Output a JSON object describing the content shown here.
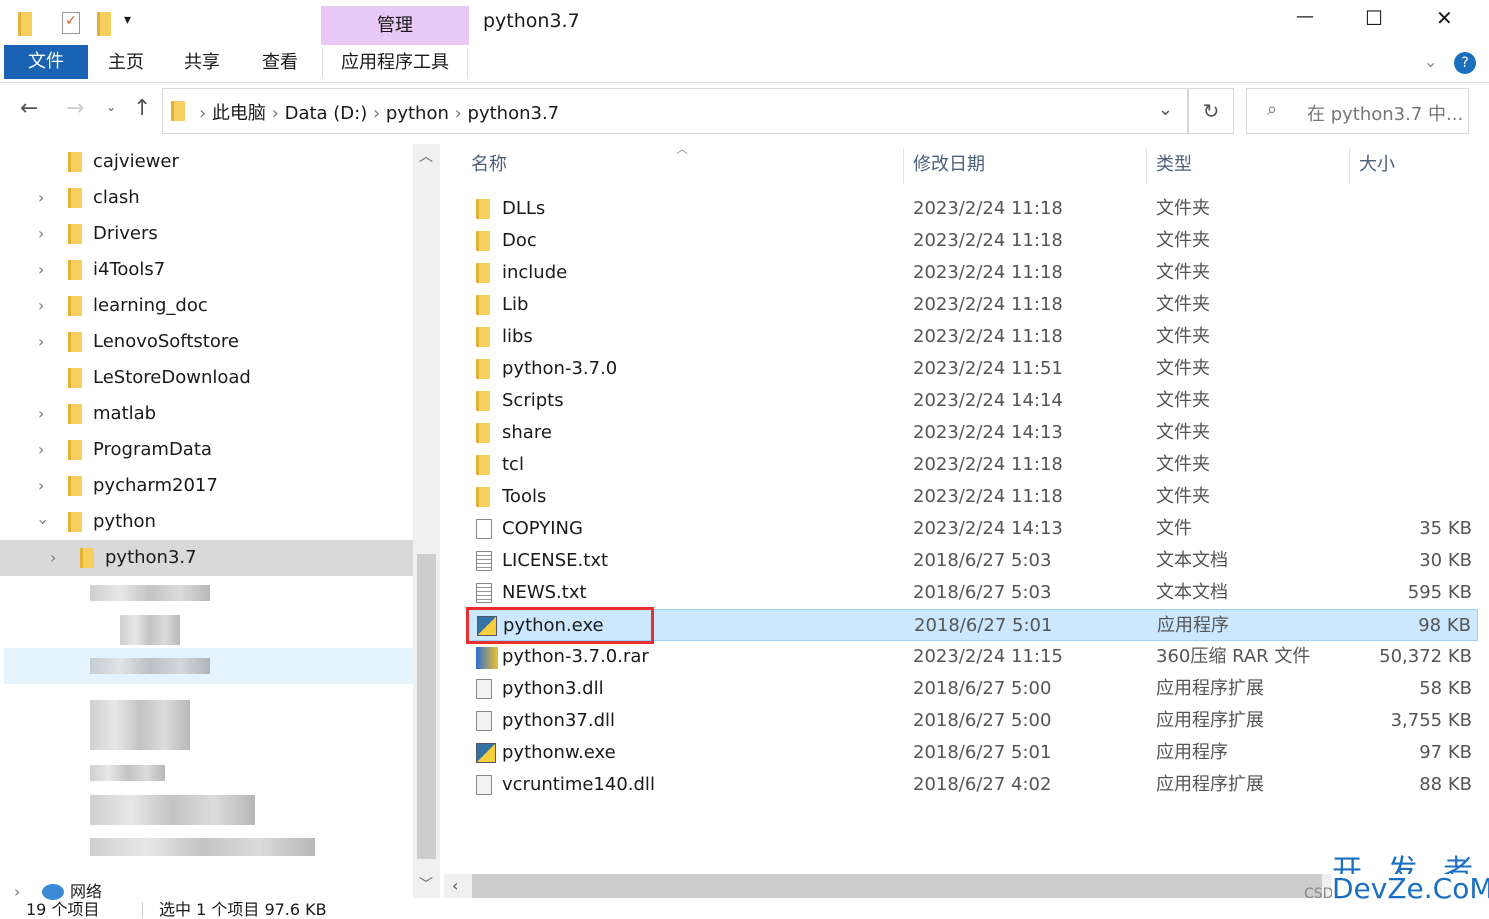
{
  "window": {
    "title": "python3.7",
    "contextual_tab": "管理",
    "min": "—",
    "max": "☐",
    "close": "✕"
  },
  "ribbon": {
    "tabs": [
      "文件",
      "主页",
      "共享",
      "查看",
      "应用程序工具"
    ]
  },
  "address": {
    "crumbs": [
      "此电脑",
      "Data (D:)",
      "python",
      "python3.7"
    ],
    "search_placeholder": "在 python3.7 中..."
  },
  "tree": {
    "items": [
      {
        "label": "cajviewer",
        "chev": false
      },
      {
        "label": "clash",
        "chev": true
      },
      {
        "label": "Drivers",
        "chev": true
      },
      {
        "label": "i4Tools7",
        "chev": true
      },
      {
        "label": "learning_doc",
        "chev": true
      },
      {
        "label": "LenovoSoftstore",
        "chev": true
      },
      {
        "label": "LeStoreDownload",
        "chev": false
      },
      {
        "label": "matlab",
        "chev": true
      },
      {
        "label": "ProgramData",
        "chev": true
      },
      {
        "label": "pycharm2017",
        "chev": true
      },
      {
        "label": "python",
        "chev": "open"
      }
    ],
    "selected": "python3.7",
    "network": "网络"
  },
  "columns": {
    "name": "名称",
    "date": "修改日期",
    "type": "类型",
    "size": "大小"
  },
  "files": [
    {
      "name": "DLLs",
      "date": "2023/2/24 11:18",
      "type": "文件夹",
      "size": "",
      "kind": "folder"
    },
    {
      "name": "Doc",
      "date": "2023/2/24 11:18",
      "type": "文件夹",
      "size": "",
      "kind": "folder"
    },
    {
      "name": "include",
      "date": "2023/2/24 11:18",
      "type": "文件夹",
      "size": "",
      "kind": "folder"
    },
    {
      "name": "Lib",
      "date": "2023/2/24 11:18",
      "type": "文件夹",
      "size": "",
      "kind": "folder"
    },
    {
      "name": "libs",
      "date": "2023/2/24 11:18",
      "type": "文件夹",
      "size": "",
      "kind": "folder"
    },
    {
      "name": "python-3.7.0",
      "date": "2023/2/24 11:51",
      "type": "文件夹",
      "size": "",
      "kind": "folder"
    },
    {
      "name": "Scripts",
      "date": "2023/2/24 14:14",
      "type": "文件夹",
      "size": "",
      "kind": "folder"
    },
    {
      "name": "share",
      "date": "2023/2/24 14:13",
      "type": "文件夹",
      "size": "",
      "kind": "folder"
    },
    {
      "name": "tcl",
      "date": "2023/2/24 11:18",
      "type": "文件夹",
      "size": "",
      "kind": "folder"
    },
    {
      "name": "Tools",
      "date": "2023/2/24 11:18",
      "type": "文件夹",
      "size": "",
      "kind": "folder"
    },
    {
      "name": "COPYING",
      "date": "2023/2/24 14:13",
      "type": "文件",
      "size": "35 KB",
      "kind": "file"
    },
    {
      "name": "LICENSE.txt",
      "date": "2018/6/27 5:03",
      "type": "文本文档",
      "size": "30 KB",
      "kind": "text"
    },
    {
      "name": "NEWS.txt",
      "date": "2018/6/27 5:03",
      "type": "文本文档",
      "size": "595 KB",
      "kind": "text"
    },
    {
      "name": "python.exe",
      "date": "2018/6/27 5:01",
      "type": "应用程序",
      "size": "98 KB",
      "kind": "exe"
    },
    {
      "name": "python-3.7.0.rar",
      "date": "2023/2/24 11:15",
      "type": "360压缩 RAR 文件",
      "size": "50,372 KB",
      "kind": "rar"
    },
    {
      "name": "python3.dll",
      "date": "2018/6/27 5:00",
      "type": "应用程序扩展",
      "size": "58 KB",
      "kind": "dll"
    },
    {
      "name": "python37.dll",
      "date": "2018/6/27 5:00",
      "type": "应用程序扩展",
      "size": "3,755 KB",
      "kind": "dll"
    },
    {
      "name": "pythonw.exe",
      "date": "2018/6/27 5:01",
      "type": "应用程序",
      "size": "97 KB",
      "kind": "exe"
    },
    {
      "name": "vcruntime140.dll",
      "date": "2018/6/27 4:02",
      "type": "应用程序扩展",
      "size": "88 KB",
      "kind": "dll"
    }
  ],
  "selected_file": "python.exe",
  "status": {
    "count": "19 个项目",
    "selection": "选中 1 个项目 97.6 KB"
  },
  "watermark": {
    "line1": "开 发 者",
    "line2": "DevZe.CoM",
    "csdn": "CSD"
  },
  "colors": {
    "accent": "#1a6fc1",
    "selection": "#cce8ff",
    "highlight_box": "#e8302f",
    "contextual": "#e9c8f5"
  }
}
